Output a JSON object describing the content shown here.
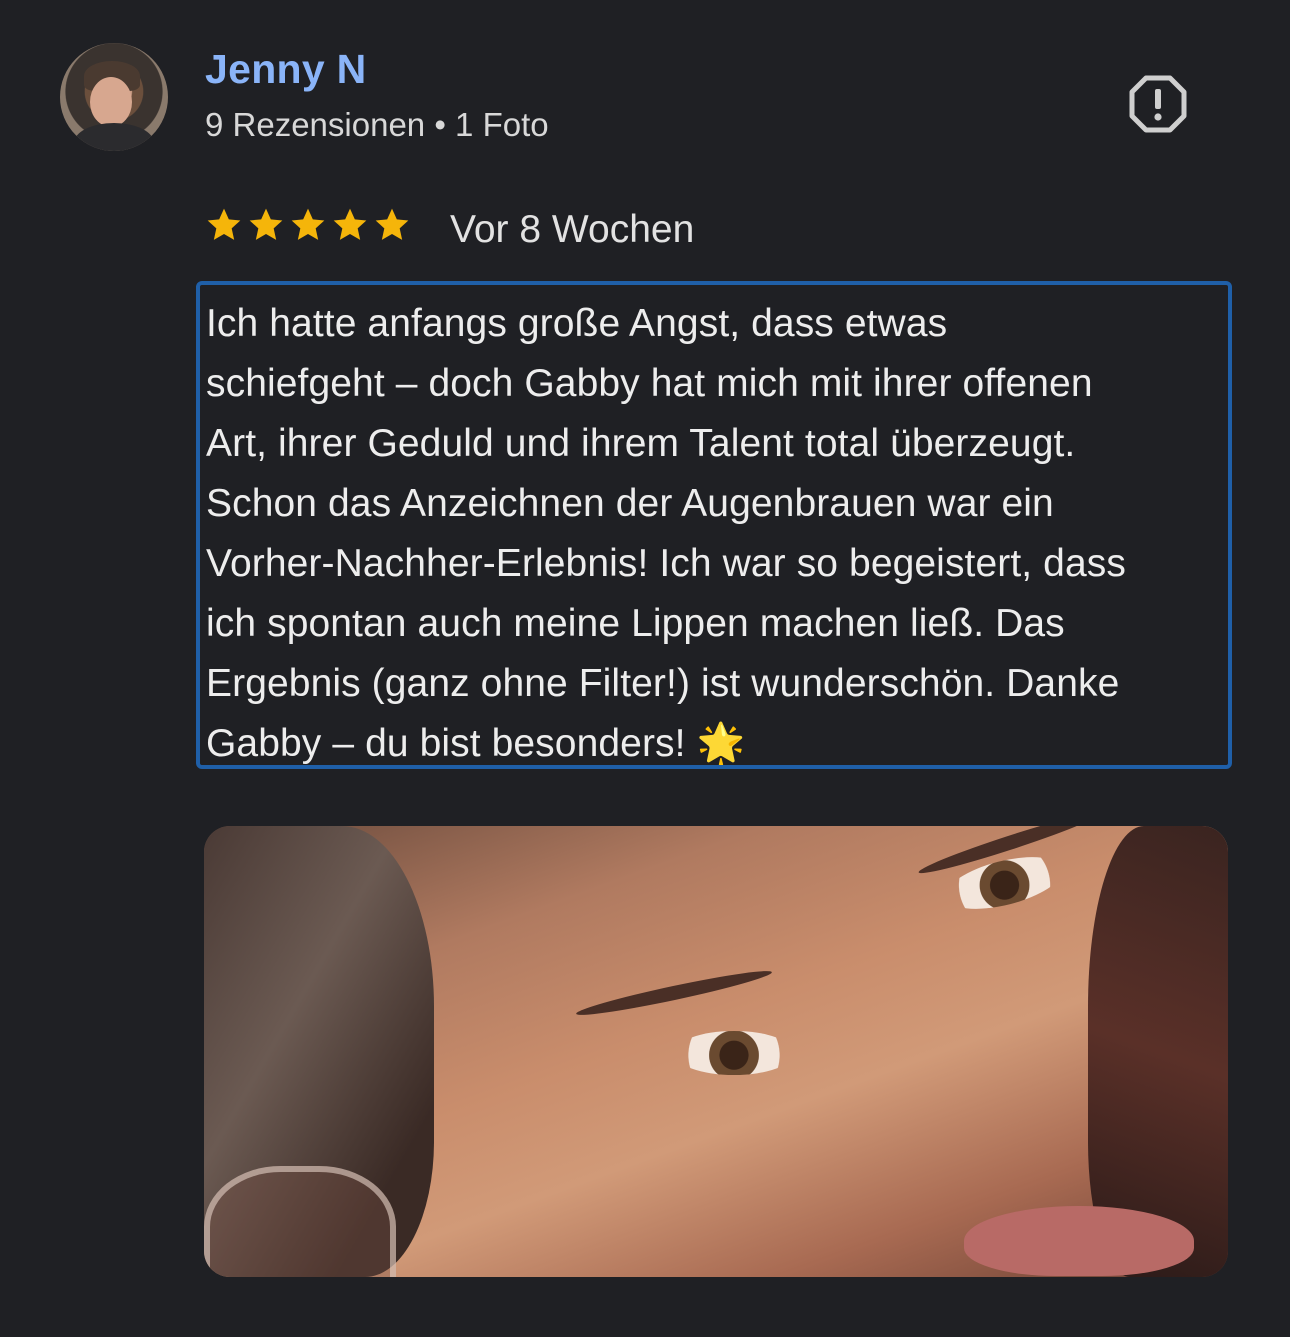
{
  "reviewer": {
    "name": "Jenny N",
    "meta": "9 Rezensionen • 1 Foto",
    "avatar_icon": "user-avatar"
  },
  "actions": {
    "report_icon": "report-flag-icon"
  },
  "rating": {
    "stars": 5,
    "max": 5,
    "star_color": "#f5b50a"
  },
  "review": {
    "date": "Vor 8 Wochen",
    "text": "Ich hatte anfangs große Angst, dass etwas\nschiefgeht – doch Gabby hat mich mit ihrer offenen\nArt, ihrer Geduld und ihrem Talent total überzeugt.\nSchon das Anzeichnen der Augenbrauen war ein\nVorher-Nachher-Erlebnis! Ich war so begeistert, dass\nich spontan auch meine Lippen machen ließ. Das\nErgebnis (ganz ohne Filter!) ist wunderschön. Danke\nGabby – du bist besonders! 🌟"
  },
  "colors": {
    "background": "#1f2024",
    "name": "#8ab4f8",
    "highlight_border": "#1f5fa8"
  }
}
